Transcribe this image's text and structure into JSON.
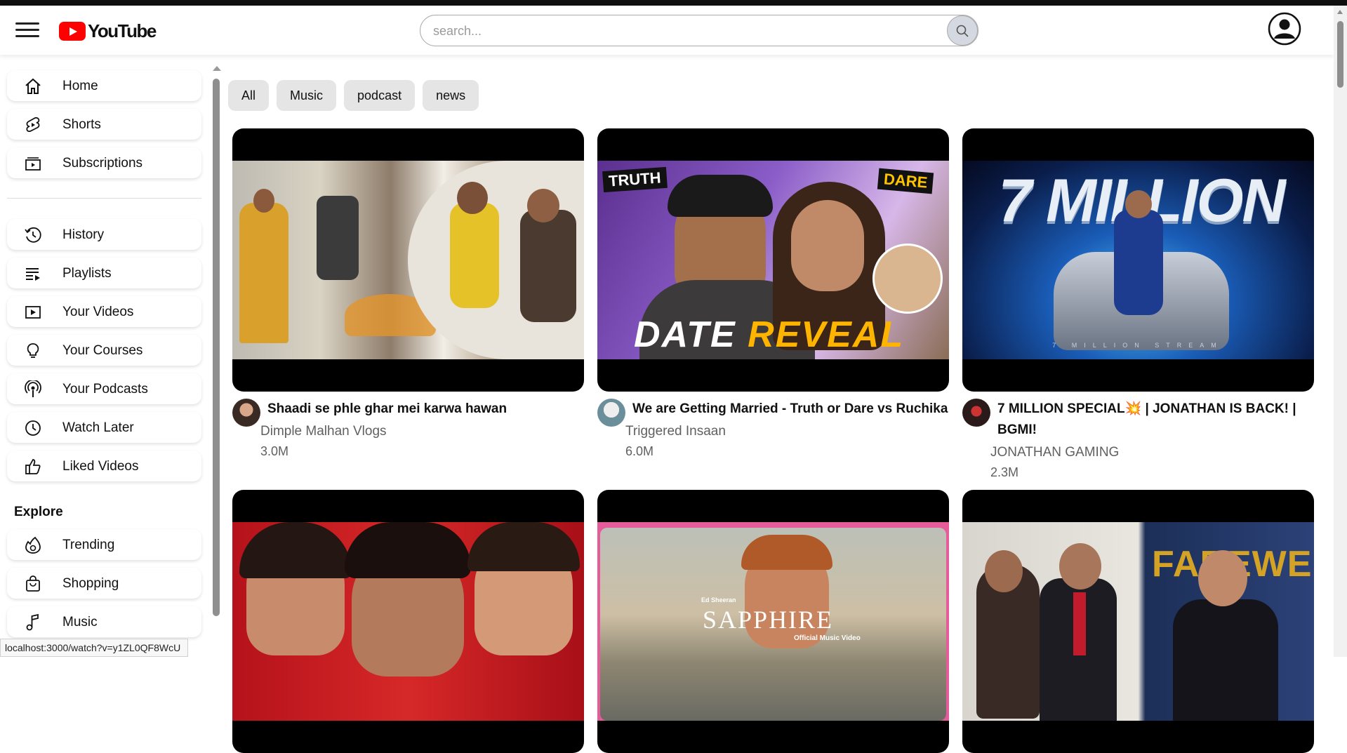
{
  "app": {
    "title": "YouTube"
  },
  "header": {
    "logo_text": "YouTube",
    "search_placeholder": "search...",
    "search_value": ""
  },
  "sidebar": {
    "primary": [
      {
        "label": "Home",
        "icon": "home-icon"
      },
      {
        "label": "Shorts",
        "icon": "shorts-icon"
      },
      {
        "label": "Subscriptions",
        "icon": "subscriptions-icon"
      }
    ],
    "library": [
      {
        "label": "History",
        "icon": "history-icon"
      },
      {
        "label": "Playlists",
        "icon": "playlists-icon"
      },
      {
        "label": "Your Videos",
        "icon": "your-videos-icon"
      },
      {
        "label": "Your Courses",
        "icon": "lightbulb-icon"
      },
      {
        "label": "Your Podcasts",
        "icon": "podcast-icon"
      },
      {
        "label": "Watch Later",
        "icon": "clock-icon"
      },
      {
        "label": "Liked Videos",
        "icon": "thumbs-up-icon"
      }
    ],
    "explore_heading": "Explore",
    "explore": [
      {
        "label": "Trending",
        "icon": "trending-icon"
      },
      {
        "label": "Shopping",
        "icon": "shopping-bag-icon"
      },
      {
        "label": "Music",
        "icon": "music-note-icon"
      }
    ]
  },
  "chips": [
    "All",
    "Music",
    "podcast",
    "news"
  ],
  "videos": [
    {
      "title": "Shaadi se phle ghar mei karwa hawan",
      "channel": "Dimple Malhan Vlogs",
      "views": "3.0M"
    },
    {
      "title": "We are Getting Married - Truth or Dare vs Ruchika",
      "channel": "Triggered Insaan",
      "views": "6.0M",
      "thumb_text": [
        "TRUTH",
        "DARE",
        "DATE",
        "REVEAL"
      ]
    },
    {
      "title": "7 MILLION SPECIAL💥 | JONATHAN IS BACK! | BGMI!",
      "channel": "JONATHAN GAMING",
      "views": "2.3M",
      "thumb_text": [
        "7 MILLION",
        "7 MILLION STREAM"
      ]
    },
    {
      "title": "",
      "channel": "",
      "views": ""
    },
    {
      "title": "",
      "channel": "",
      "views": "",
      "thumb_text": [
        "Ed Sheeran",
        "SAPPHIRE",
        "Official Music Video"
      ]
    },
    {
      "title": "",
      "channel": "",
      "views": "",
      "thumb_text": [
        "FAREWELL"
      ]
    }
  ],
  "status_bar": {
    "url": "localhost:3000/watch?v=y1ZL0QF8WcU"
  },
  "colors": {
    "brand": "#ff0000",
    "chip_bg": "#e5e5e5",
    "search_btn": "#d4d8e0"
  }
}
